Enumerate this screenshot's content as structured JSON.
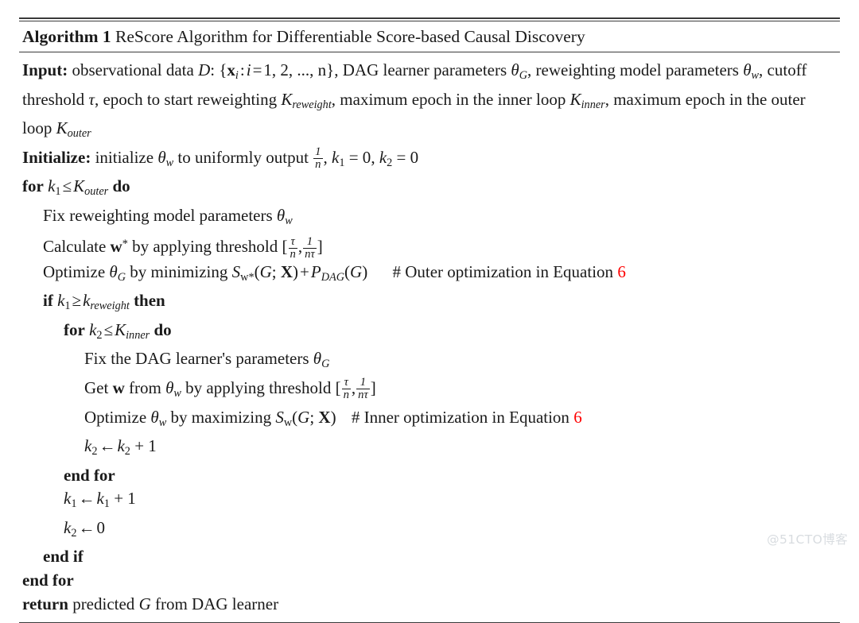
{
  "document": {
    "type": "algorithm-pseudocode-figure",
    "caption_prefix": "Algorithm 1",
    "caption_title": "ReScore Algorithm for Differentiable Score-based Causal Discovery",
    "accent_color": "#ff0000",
    "rule_color": "#3a3a3a",
    "background": "#ffffff"
  },
  "input_block": {
    "label": "Input:",
    "text_1": "observational data",
    "symbol_dataset": "D",
    "colon": ":",
    "set_open": "{",
    "var_x": "x",
    "var_x_sub": "i",
    "sep": ":",
    "index_var": "i",
    "equals": "=",
    "index_values": "1, 2, ..., n",
    "set_close": "}",
    "comma_1": ",",
    "text_2": "DAG learner parameters",
    "theta_G": "θ",
    "theta_G_sub": "G",
    "comma_2": ",",
    "text_3": "reweighting model parameters",
    "theta_w": "θ",
    "theta_w_sub": "w",
    "comma_3": ",",
    "text_4": "cutoff threshold",
    "tau": "τ",
    "comma_4": ",",
    "text_5": "epoch to start reweighting",
    "K_reweight": "K",
    "K_reweight_sub": "reweight",
    "comma_5": ",",
    "text_6": "maximum epoch in the inner loop",
    "K_inner": "K",
    "K_inner_sub": "inner",
    "comma_6": ",",
    "text_7": "maximum epoch in the outer loop",
    "K_outer": "K",
    "K_outer_sub": "outer"
  },
  "initialize_block": {
    "label": "Initialize:",
    "text_1": "initialize",
    "theta_w": "θ",
    "theta_w_sub": "w",
    "text_2": "to uniformly output",
    "frac_num": "1",
    "frac_den": "n",
    "comma_1": ",",
    "k1": "k",
    "k1_sub": "1",
    "eq1": "= 0",
    "comma_2": ",",
    "k2": "k",
    "k2_sub": "2",
    "eq2": "= 0"
  },
  "lines": [
    {
      "id": "for-outer",
      "indent": 0,
      "keyword_start": "for",
      "condition": "k₁ ≤ K_outer",
      "keyword_end": "do"
    },
    {
      "id": "fix-reweighting",
      "indent": 1,
      "text": "Fix reweighting model parameters θ_w"
    },
    {
      "id": "calculate-w-star",
      "indent": 1,
      "text": "Calculate w* by applying threshold [τ/n, 1/(nτ)]"
    },
    {
      "id": "optimize-theta-g",
      "indent": 1,
      "text": "Optimize θ_G by minimizing S_w*(G; X) + P_DAG(G)",
      "comment": "# Outer optimization in Equation",
      "comment_ref": "6"
    },
    {
      "id": "if-reweight",
      "indent": 1,
      "keyword_start": "if",
      "condition": "k₁ ≥ k_reweight",
      "keyword_end": "then"
    },
    {
      "id": "for-inner",
      "indent": 2,
      "keyword_start": "for",
      "condition": "k₂ ≤ K_inner",
      "keyword_end": "do"
    },
    {
      "id": "fix-dag-learner",
      "indent": 3,
      "text": "Fix the DAG learner's parameters θ_G"
    },
    {
      "id": "get-w",
      "indent": 3,
      "text": "Get w from θ_w by applying threshold [τ/n, 1/(nτ)]"
    },
    {
      "id": "optimize-theta-w",
      "indent": 3,
      "text": "Optimize θ_w by maximizing S_w(G; X)",
      "comment": "# Inner optimization in Equation",
      "comment_ref": "6"
    },
    {
      "id": "increment-k2",
      "indent": 3,
      "text": "k₂ ← k₂ + 1"
    },
    {
      "id": "end-for-inner",
      "indent": 2,
      "keyword_start": "end for"
    },
    {
      "id": "increment-k1",
      "indent": 2,
      "text": "k₁ ← k₁ + 1"
    },
    {
      "id": "reset-k2",
      "indent": 2,
      "text": "k₂ ← 0"
    },
    {
      "id": "end-if",
      "indent": 1,
      "keyword_start": "end if"
    },
    {
      "id": "end-for-outer",
      "indent": 0,
      "keyword_start": "end for"
    },
    {
      "id": "return",
      "indent": 0,
      "keyword_start": "return",
      "text": "predicted G from DAG learner"
    }
  ],
  "labels": {
    "for": "for",
    "do": "do",
    "if": "if",
    "then": "then",
    "end_for": "end for",
    "end_if": "end if",
    "return": "return",
    "fix_reweighting": "Fix reweighting model parameters",
    "calculate": "Calculate",
    "by_applying_threshold": "by applying threshold",
    "optimize": "Optimize",
    "by_minimizing": "by minimizing",
    "by_maximizing": "by maximizing",
    "fix_dag": "Fix the DAG learner's parameters",
    "get": "Get",
    "from": "from",
    "predicted": "predicted",
    "from_dag_learner": "from DAG learner",
    "comment_outer": "# Outer optimization in Equation",
    "comment_inner": "# Inner optimization in Equation",
    "eq_ref": "6",
    "arrow": "←",
    "plus_one": "+ 1",
    "zero": "0",
    "leq": "≤",
    "geq": "≥",
    "plus": "+",
    "semicolon": ";",
    "star": "*",
    "bracket_open": "[",
    "bracket_close": "]",
    "paren_open": "(",
    "paren_close": ")",
    "comma": ",",
    "S": "S",
    "P": "P",
    "DAG": "DAG",
    "G": "G",
    "X": "X",
    "w": "w",
    "theta": "θ",
    "tau": "τ",
    "n": "n",
    "one": "1",
    "k": "k",
    "K": "K",
    "sub_1": "1",
    "sub_2": "2",
    "sub_outer": "outer",
    "sub_inner": "inner",
    "sub_reweight": "reweight",
    "sub_w": "w",
    "sub_G": "G"
  },
  "watermark": {
    "text": "@51CTO博客",
    "color": "#d8dce0"
  }
}
